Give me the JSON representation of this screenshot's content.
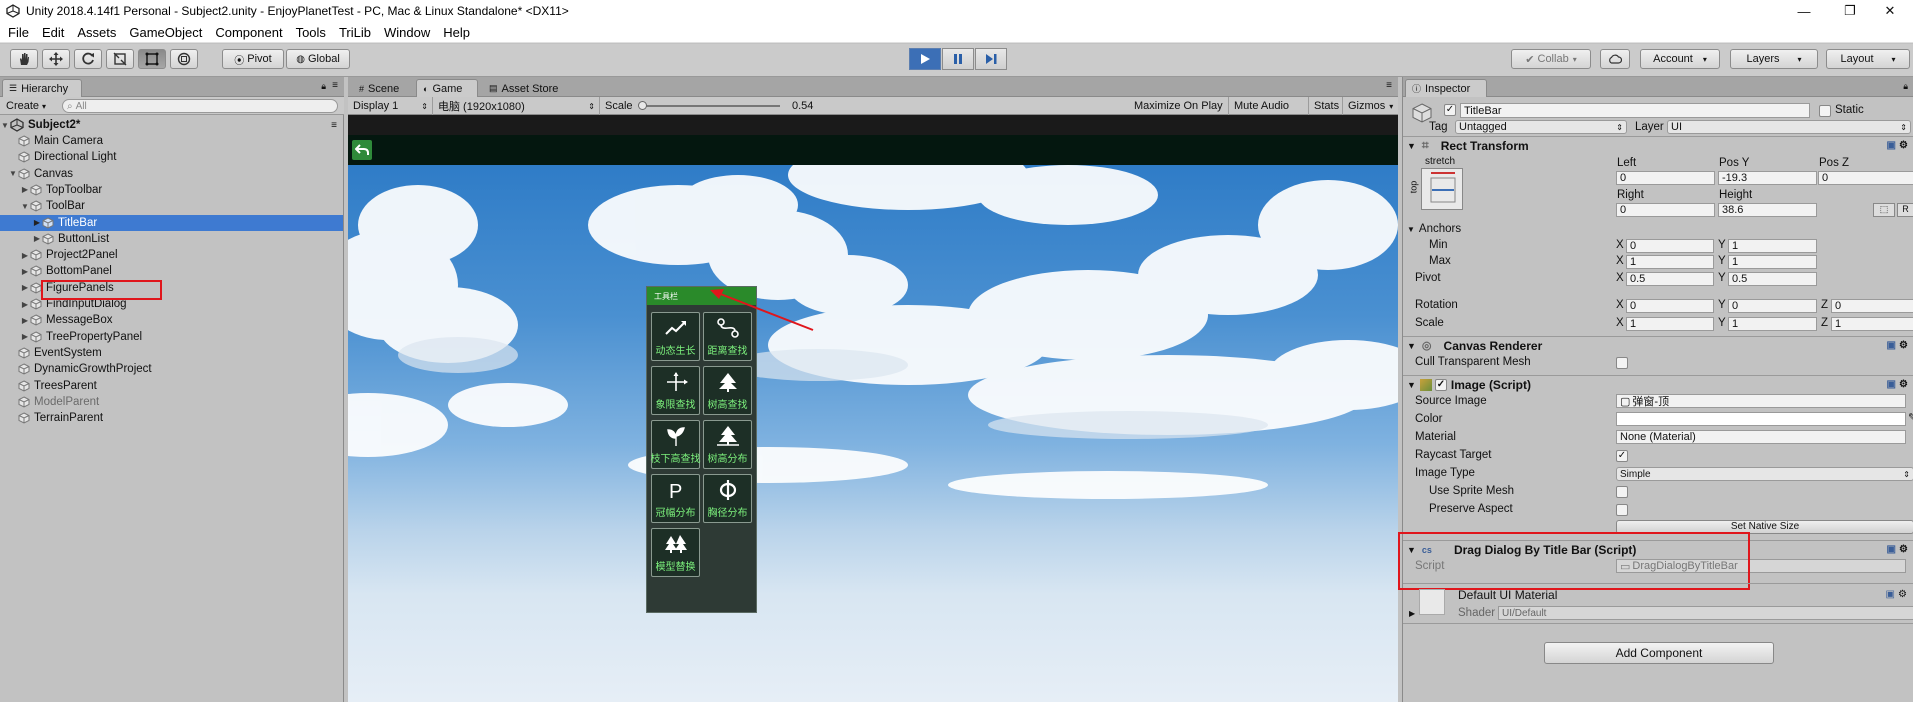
{
  "window": {
    "title": "Unity 2018.4.14f1 Personal - Subject2.unity - EnjoyPlanetTest - PC, Mac & Linux Standalone* <DX11>"
  },
  "menu": [
    "File",
    "Edit",
    "Assets",
    "GameObject",
    "Component",
    "Tools",
    "TriLib",
    "Window",
    "Help"
  ],
  "toolbar": {
    "pivot": "Pivot",
    "global": "Global",
    "collab": "Collab",
    "account": "Account",
    "layers": "Layers",
    "layout": "Layout"
  },
  "hierarchy": {
    "tab": "Hierarchy",
    "create": "Create",
    "search_placeholder": "All",
    "scene": "Subject2*",
    "items": [
      {
        "label": "Main Camera"
      },
      {
        "label": "Directional Light"
      },
      {
        "label": "Canvas"
      },
      {
        "label": "TopToolbar"
      },
      {
        "label": "ToolBar"
      },
      {
        "label": "TitleBar"
      },
      {
        "label": "ButtonList"
      },
      {
        "label": "Project2Panel"
      },
      {
        "label": "BottomPanel"
      },
      {
        "label": "FigurePanels"
      },
      {
        "label": "FindInputDialog"
      },
      {
        "label": "MessageBox"
      },
      {
        "label": "TreePropertyPanel"
      },
      {
        "label": "EventSystem"
      },
      {
        "label": "DynamicGrowthProject"
      },
      {
        "label": "TreesParent"
      },
      {
        "label": "ModelParent"
      },
      {
        "label": "TerrainParent"
      }
    ]
  },
  "game": {
    "tabs": [
      "Scene",
      "Game",
      "Asset Store"
    ],
    "display": "Display 1",
    "resolution": "电脑 (1920x1080)",
    "scale_label": "Scale",
    "scale_value": "0.54",
    "maximize": "Maximize On Play",
    "mute": "Mute Audio",
    "stats": "Stats",
    "gizmos": "Gizmos",
    "panel_title": "工具栏",
    "tools": [
      "动态生长",
      "距离查找",
      "象限查找",
      "树高查找",
      "枝下高查找",
      "树高分布",
      "冠幅分布",
      "胸径分布",
      "模型替换"
    ]
  },
  "inspector": {
    "tab": "Inspector",
    "object_name": "TitleBar",
    "static_label": "Static",
    "tag_label": "Tag",
    "tag_value": "Untagged",
    "layer_label": "Layer",
    "layer_value": "UI",
    "rect_transform": {
      "header": "Rect Transform",
      "stretch": "stretch",
      "top": "top",
      "left_label": "Left",
      "left": "0",
      "posy_label": "Pos Y",
      "posy": "-19.3",
      "posz_label": "Pos Z",
      "posz": "0",
      "right_label": "Right",
      "right": "0",
      "height_label": "Height",
      "height": "38.6",
      "r_btn": "R",
      "anchors": "Anchors",
      "min": "Min",
      "min_x": "0",
      "min_y": "1",
      "max": "Max",
      "max_x": "1",
      "max_y": "1",
      "pivot": "Pivot",
      "pivot_x": "0.5",
      "pivot_y": "0.5",
      "rotation": "Rotation",
      "rot_x": "0",
      "rot_y": "0",
      "rot_z": "0",
      "scale": "Scale",
      "scale_x": "1",
      "scale_y": "1",
      "scale_z": "1"
    },
    "canvas_renderer": {
      "header": "Canvas Renderer",
      "cull": "Cull Transparent Mesh"
    },
    "image": {
      "header": "Image (Script)",
      "source_image_label": "Source Image",
      "source_image": "弹窗-顶",
      "color_label": "Color",
      "material_label": "Material",
      "material": "None (Material)",
      "raycast_label": "Raycast Target",
      "image_type_label": "Image Type",
      "image_type": "Simple",
      "use_sprite_mesh": "Use Sprite Mesh",
      "preserve_aspect": "Preserve Aspect",
      "set_native": "Set Native Size"
    },
    "drag_dialog": {
      "header": "Drag Dialog By Title Bar (Script)",
      "script_label": "Script",
      "script_value": "DragDialogByTitleBar"
    },
    "material": {
      "name": "Default UI Material",
      "shader_label": "Shader",
      "shader_value": "UI/Default"
    },
    "add_component": "Add Component"
  },
  "colors": {
    "selection": "#3e7ad1",
    "highlight_box": "#e0161c",
    "play_active": "#3c6fb6",
    "tool_text": "#7cf07c"
  }
}
